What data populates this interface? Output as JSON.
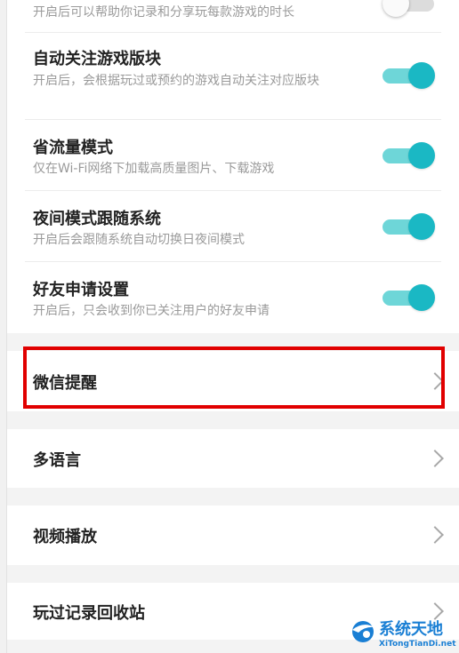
{
  "settings": {
    "partial_row": {
      "desc": "开启后可以帮助你记录和分享玩每款游戏的时长",
      "toggle_on": false
    },
    "auto_follow": {
      "title": "自动关注游戏版块",
      "desc": "开启后，会根据玩过或预约的游戏自动关注对应版块",
      "toggle_on": true
    },
    "data_saver": {
      "title": "省流量模式",
      "desc": "仅在Wi-Fi网络下加载高质量图片、下载游戏",
      "toggle_on": true
    },
    "night_mode": {
      "title": "夜间模式跟随系统",
      "desc": "开启后会跟随系统自动切换日夜间模式",
      "toggle_on": true
    },
    "friend_request": {
      "title": "好友申请设置",
      "desc": "开启后，只会收到你已关注用户的好友申请",
      "toggle_on": true
    }
  },
  "menu": {
    "wechat_reminder": "微信提醒",
    "language": "多语言",
    "video_playback": "视频播放",
    "played_recycle_bin": "玩过记录回收站"
  },
  "watermark": {
    "title": "系统天地",
    "url": "XiTongTianDi.net"
  },
  "colors": {
    "toggle_track": "#6ed6d8",
    "toggle_knob": "#1ab8c4",
    "highlight": "#e10000",
    "section_gap": "#f3f3f3"
  }
}
